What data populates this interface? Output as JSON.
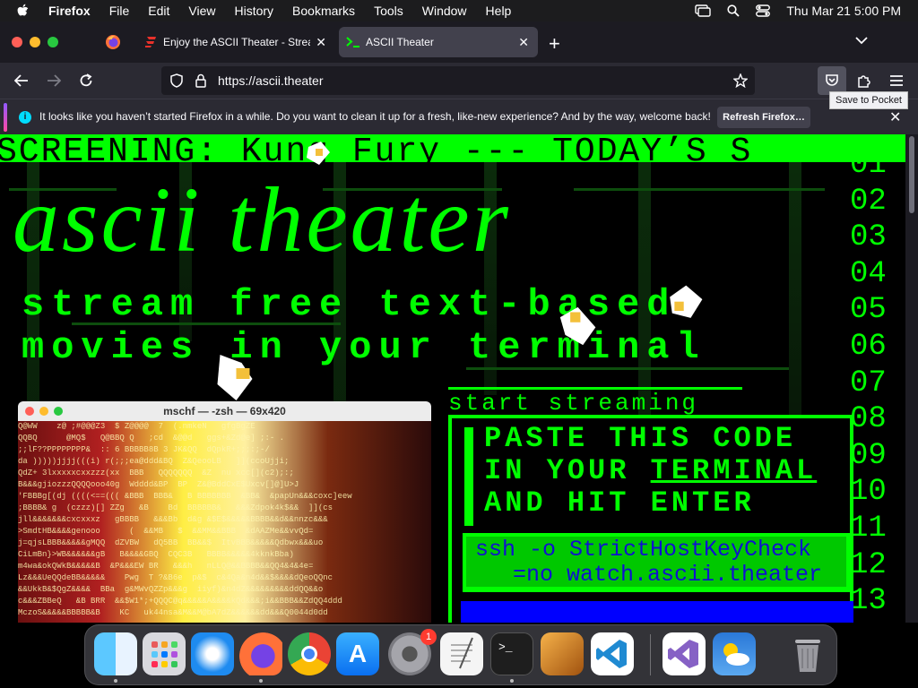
{
  "menubar": {
    "app": "Firefox",
    "items": [
      "File",
      "Edit",
      "View",
      "History",
      "Bookmarks",
      "Tools",
      "Window",
      "Help"
    ],
    "clock": "Thu Mar 21  5:00 PM"
  },
  "tabs": [
    {
      "title": "Enjoy the ASCII Theater - Strea",
      "active": false
    },
    {
      "title": "ASCII Theater",
      "active": true
    }
  ],
  "url": "https://ascii.theater",
  "tooltip": "Save to Pocket",
  "notification": {
    "message": "It looks like you haven’t started Firefox in a while. Do you want to clean it up for a fresh, like-new experience? And by the way, welcome back!",
    "button": "Refresh Firefox…"
  },
  "page": {
    "ticker": "SCREENING: Kung Fury --- TODAY’S S",
    "hero": "ascii theater",
    "tagline1": "stream free text-based",
    "tagline2": "movies in your terminal",
    "start_title": "start streaming",
    "instr1": "PASTE THIS CODE",
    "instr2a": "IN YOUR ",
    "instr2b": "TERMINAL",
    "instr3": "AND HIT ENTER",
    "cmd1": "ssh -o StrictHostKeyCheck",
    "cmd2": "=no watch.ascii.theater",
    "line_numbers": [
      "01",
      "02",
      "03",
      "04",
      "05",
      "06",
      "07",
      "08",
      "09",
      "10",
      "11",
      "12",
      "13"
    ],
    "colors": {
      "accent": "#00ff00",
      "command_text": "#1010d0",
      "bottom_block": "#0000ff"
    }
  },
  "terminal": {
    "title": "mschf — -zsh — 69x420",
    "ascii_art": "Q@WW    z@ ;#@@@Z3  $ Z@@@@  7  (.nmkeN   gfgBgZE\nQQBQ      @MQ$   Q@BBQ Q   ;cd  &@@d   ggs+&Zd@e] ;:- .\n;;lF??PPPPPPPP&  :: 6 BBBBB8B 3 JK&QQ  dQpkR+;;;:;-/\nda )))))jjjj(((i) r(;;;ea@ddd&BQ  Z&QeooLB   ]](ccoUjji;\nQdZ+ 3lxxxxxcxxzzz(xx  BBB   QQQQQQQ  &Z  nu xcc[](c2);:;\nB&&&gjiozzzQQQQooo40g  Wdddd&BP  BP  Z&@BddCxE$Uxcv[]@]U>J\n'FBBBg[(dj ((((<==((( &BBB  BBB&   B BBBBBBB  &BB&  &papUn&&&coxc]eew\n;BBBB& g  (czzz)[] ZZg   &B    Bd  BBBBBB&   &&&Zdpok4k$&&  ]](cs\njll&&&&&&&cxcxxxz   gBBBB   &&&Bb  d&g &$E$&&&&&BBBB&&d&&nnzc&&&\n>SmdtHB&&&&genooo      (  &&MB   $  &&MM&&BBB  &dAAZMe&&vvQd=\nj=qjsLBBB&&&&&gMQQ  dZVBW   dQ5BB  BB&&$  ItvBBB&&&&&Qdbwx&&&uo\nCiLmBn}>WB&&&&&&gB   B&&&&GBQ  CQC3B   BBBB&&&&&4kknkBba)\nm4wa&okQWkB&&&&&B  &P&&&EW BR   &&&h   nLLQ@&&BBBB&&QQ4&4&4e=\nLz&&&UeQQdeBB&&&&&    Pwg  T ?&B6e  p&$  c&4Qa&n4d&&$&&&&dQeoQQnc\n&&UkkB&$QgZ&&&&  BBa  g&MWvQZZp&&&g  iiyf)&n4dZ&&&&&&&&&ddQQ&&o\nc&&&ZBBeQ   &B BRR  &&$W1*;+QQQC@q&&&&&A&&&&kQd&&&;i&&BBB&&ZdQQ4ddd\nMczoS&&&&&BBBBB&B    KC   uk44nsa&M&&M@bA7dZ&&&&&&dd&&&Q0044d0dd"
  },
  "dock": [
    {
      "name": "finder",
      "color": "#2aa3f5",
      "running": true
    },
    {
      "name": "launchpad",
      "color": "#c9c9d1",
      "running": false
    },
    {
      "name": "safari",
      "color": "#1e8bf0",
      "running": false
    },
    {
      "name": "firefox",
      "color": "#ff7a1a",
      "running": true
    },
    {
      "name": "chrome",
      "color": "#ffffff",
      "running": false
    },
    {
      "name": "app-store",
      "color": "#1a8cff",
      "running": false
    },
    {
      "name": "system-settings",
      "color": "#8e8e93",
      "running": false,
      "badge": "1"
    },
    {
      "name": "textedit",
      "color": "#f5f5f5",
      "running": false
    },
    {
      "name": "terminal",
      "color": "#1e1e1e",
      "running": true
    },
    {
      "name": "garageband",
      "color": "#f0a030",
      "running": false
    },
    {
      "name": "vscode",
      "color": "#ffffff",
      "running": false
    },
    {
      "name": "visual-studio",
      "color": "#ffffff",
      "running": false
    },
    {
      "name": "weather",
      "color": "#3a8ee6",
      "running": false
    },
    {
      "name": "trash",
      "color": "#9a9aa0",
      "running": false
    }
  ]
}
